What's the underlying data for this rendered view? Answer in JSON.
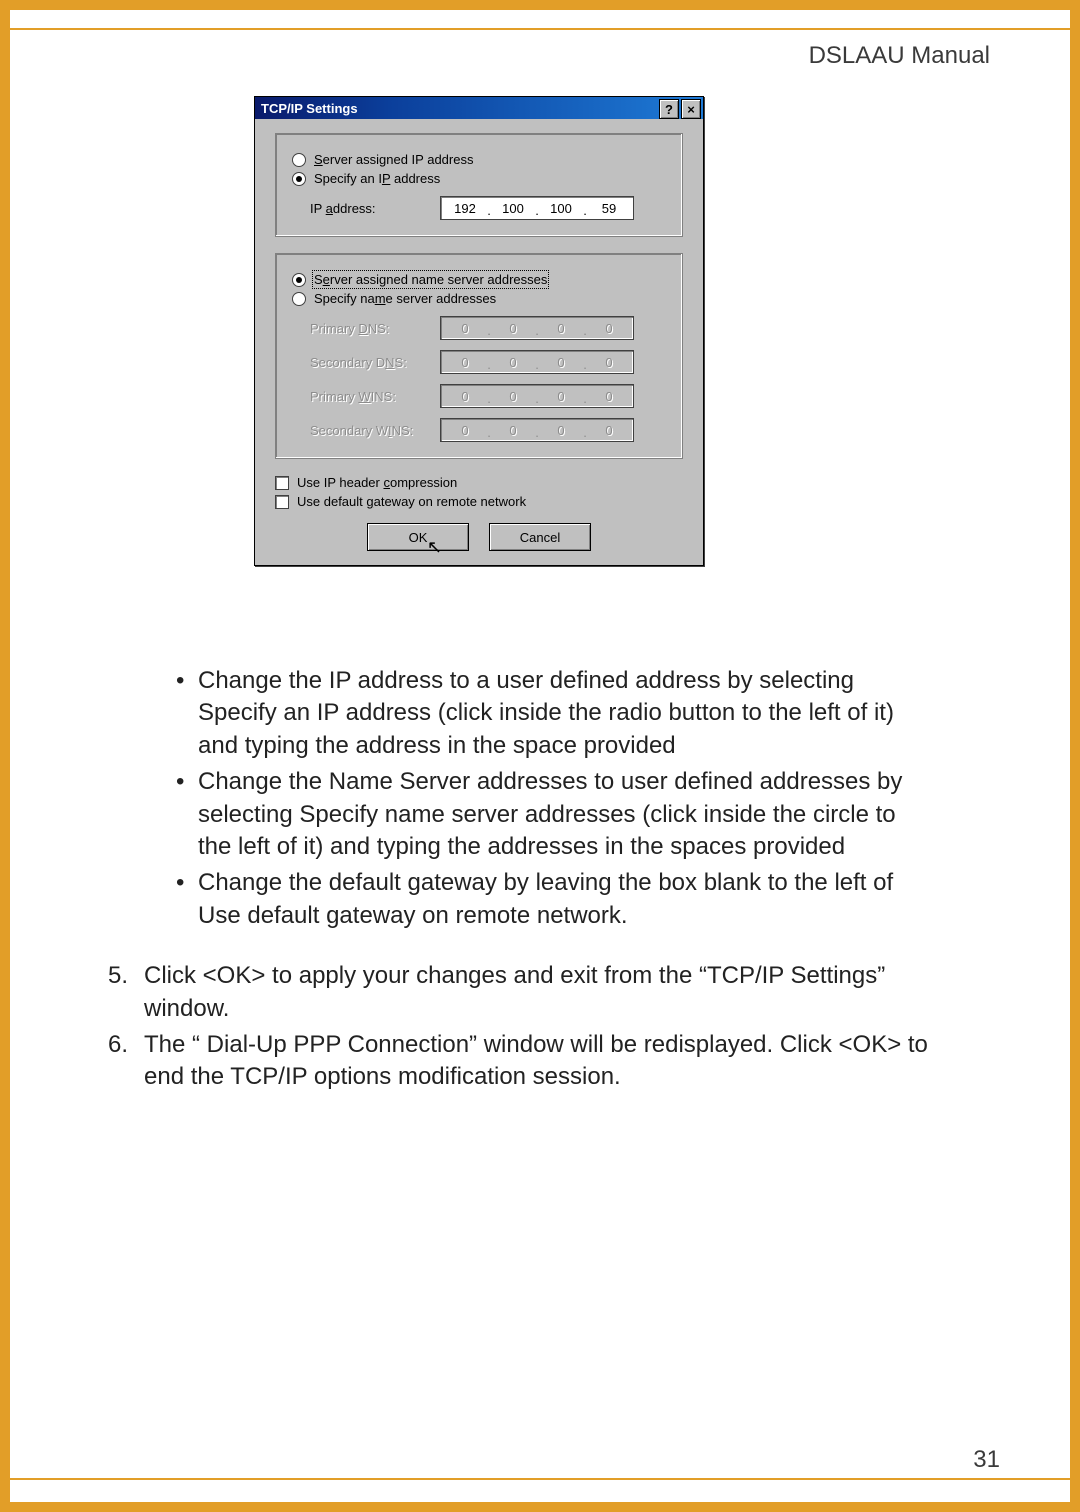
{
  "manual_title": "DSLAAU Manual",
  "page_number": "31",
  "dialog": {
    "title": "TCP/IP Settings",
    "help_btn": "?",
    "close_btn": "×",
    "group_ip": {
      "radio_server_assigned": "Server assigned IP address",
      "radio_specify": "Specify an IP address",
      "ip_label": "IP address:",
      "ip_octets": [
        "192",
        "100",
        "100",
        "59"
      ]
    },
    "group_nameserver": {
      "radio_server_assigned": "Server assigned name server addresses",
      "radio_specify": "Specify name server addresses",
      "primary_dns_label": "Primary DNS:",
      "secondary_dns_label": "Secondary DNS:",
      "primary_wins_label": "Primary WINS:",
      "secondary_wins_label": "Secondary WINS:",
      "zero_octets": [
        "0",
        "0",
        "0",
        "0"
      ]
    },
    "check_header_compression": "Use IP header compression",
    "check_default_gateway": "Use default gateway on remote network",
    "ok_btn": "OK",
    "cancel_btn": "Cancel"
  },
  "instructions": {
    "bullets": [
      "Change the IP address to a user defined address by selecting Specify an IP address (click inside the radio button to the left of it) and typing the address in the space provided",
      "Change the Name Server addresses to user defined addresses by selecting Specify name server addresses (click inside the circle to the left of it) and typing the addresses in the spaces provided",
      "Change the default gateway by leaving the box blank to the left of Use default gateway on remote network."
    ],
    "step5_num": "5.",
    "step5_text": "Click <OK> to apply your changes and exit from the “TCP/IP Settings” window.",
    "step6_num": "6.",
    "step6_text": "The “ Dial-Up PPP Connection” window will be redisplayed. Click <OK> to end the TCP/IP options modification session."
  }
}
